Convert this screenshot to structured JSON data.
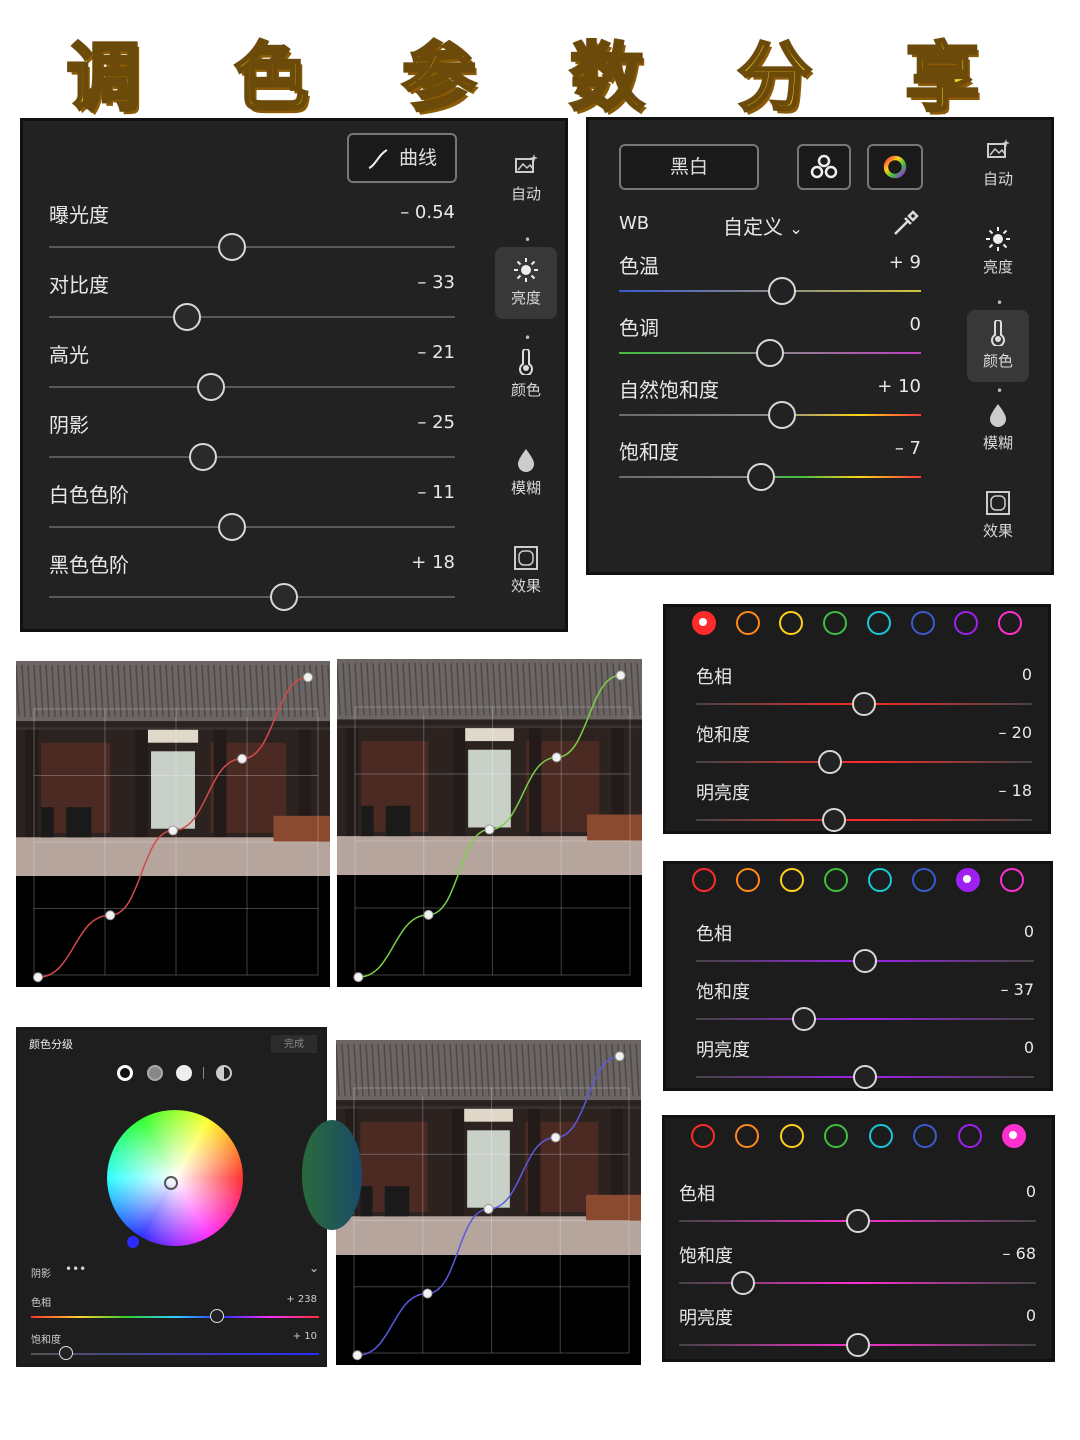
{
  "title": "调 色 参 数 分 享",
  "light_panel": {
    "curve_button": "曲线",
    "sliders": [
      {
        "label": "曝光度",
        "value": "– 0.54",
        "pos": 0.45
      },
      {
        "label": "对比度",
        "value": "– 33",
        "pos": 0.34
      },
      {
        "label": "高光",
        "value": "– 21",
        "pos": 0.4
      },
      {
        "label": "阴影",
        "value": "– 25",
        "pos": 0.38
      },
      {
        "label": "白色色阶",
        "value": "– 11",
        "pos": 0.45
      },
      {
        "label": "黑色色阶",
        "value": "+ 18",
        "pos": 0.58
      }
    ],
    "side": [
      {
        "label": "自动",
        "icon": "auto-icon"
      },
      {
        "label": "亮度",
        "icon": "sun-icon",
        "active": true
      },
      {
        "label": "颜色",
        "icon": "thermometer-icon"
      },
      {
        "label": "模糊",
        "icon": "drop-icon"
      },
      {
        "label": "效果",
        "icon": "frame-icon"
      }
    ]
  },
  "color_panel": {
    "bw_button": "黑白",
    "wb_label": "WB",
    "wb_value": "自定义",
    "sliders": [
      {
        "label": "色温",
        "value": "+ 9",
        "pos": 0.54
      },
      {
        "label": "色调",
        "value": "0",
        "pos": 0.5
      },
      {
        "label": "自然饱和度",
        "value": "+ 10",
        "pos": 0.54
      },
      {
        "label": "饱和度",
        "value": "– 7",
        "pos": 0.47
      }
    ],
    "side": [
      {
        "label": "自动",
        "icon": "auto-icon"
      },
      {
        "label": "亮度",
        "icon": "sun-icon"
      },
      {
        "label": "颜色",
        "icon": "thermometer-icon",
        "active": true
      },
      {
        "label": "模糊",
        "icon": "drop-icon"
      },
      {
        "label": "效果",
        "icon": "frame-icon"
      }
    ]
  },
  "hsl_panels": [
    {
      "selected": 0,
      "rows": [
        {
          "label": "色相",
          "value": "0",
          "pos": 0.5
        },
        {
          "label": "饱和度",
          "value": "– 20",
          "pos": 0.4
        },
        {
          "label": "明亮度",
          "value": "– 18",
          "pos": 0.41
        }
      ]
    },
    {
      "selected": 6,
      "rows": [
        {
          "label": "色相",
          "value": "0",
          "pos": 0.5
        },
        {
          "label": "饱和度",
          "value": "– 37",
          "pos": 0.32
        },
        {
          "label": "明亮度",
          "value": "0",
          "pos": 0.5
        }
      ]
    },
    {
      "selected": 7,
      "rows": [
        {
          "label": "色相",
          "value": "0",
          "pos": 0.5
        },
        {
          "label": "饱和度",
          "value": "– 68",
          "pos": 0.18
        },
        {
          "label": "明亮度",
          "value": "0",
          "pos": 0.5
        }
      ]
    }
  ],
  "ring_colors": [
    "#ff2a2a",
    "#ff8a1a",
    "#ffd21a",
    "#3fbf3f",
    "#1ac8d8",
    "#3a5bd0",
    "#a020f0",
    "#ff30d0"
  ],
  "grading": {
    "header": "颜色分级",
    "done": "完成",
    "section": "阴影",
    "hue_label": "色相",
    "hue_value": "+ 238",
    "sat_label": "饱和度",
    "sat_value": "+ 10"
  },
  "curves": [
    {
      "color": "#d24a4a"
    },
    {
      "color": "#7ad04a"
    },
    {
      "color": "#5a5ae0"
    }
  ]
}
